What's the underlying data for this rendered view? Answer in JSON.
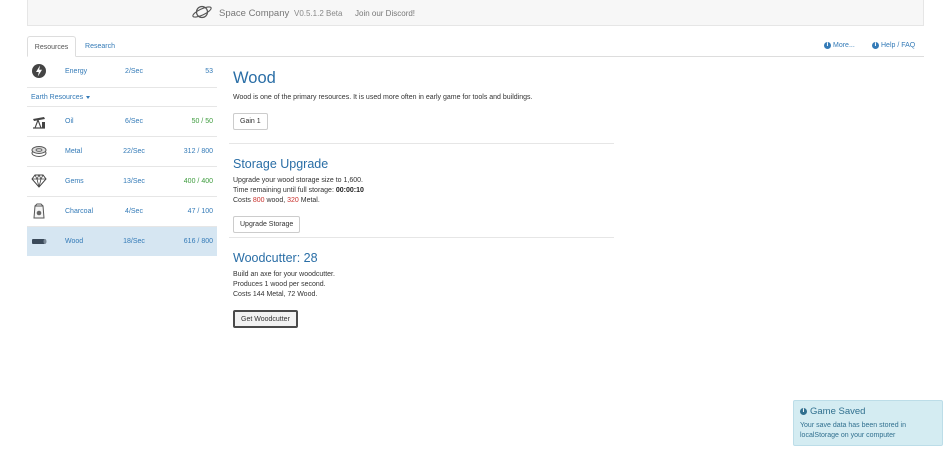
{
  "navbar": {
    "brand_name": "Space Company",
    "version": "V0.5.1.2 Beta",
    "discord_link": "Join our Discord!"
  },
  "tabs": [
    {
      "label": "Resources",
      "active": true
    },
    {
      "label": "Research",
      "active": false
    }
  ],
  "top_links": {
    "more": "More...",
    "help": "Help / FAQ"
  },
  "sidebar": {
    "energy": {
      "name": "Energy",
      "rate": "2/Sec",
      "amount": "53"
    },
    "category_label": "Earth Resources",
    "resources": [
      {
        "name": "Oil",
        "rate": "6/Sec",
        "amount": "50",
        "capacity": "50",
        "full": true,
        "active": false
      },
      {
        "name": "Metal",
        "rate": "22/Sec",
        "amount": "312",
        "capacity": "800",
        "full": false,
        "active": false
      },
      {
        "name": "Gems",
        "rate": "13/Sec",
        "amount": "400",
        "capacity": "400",
        "full": true,
        "active": false
      },
      {
        "name": "Charcoal",
        "rate": "4/Sec",
        "amount": "47",
        "capacity": "100",
        "full": false,
        "active": false
      },
      {
        "name": "Wood",
        "rate": "18/Sec",
        "amount": "616",
        "capacity": "800",
        "full": false,
        "active": true
      }
    ],
    "separator": " / "
  },
  "main": {
    "title": "Wood",
    "description": "Wood is one of the primary resources. It is used more often in early game for tools and buildings.",
    "gain_button": "Gain 1",
    "storage": {
      "title": "Storage Upgrade",
      "line1": "Upgrade your wood storage size to 1,600.",
      "line2_prefix": "Time remaining until full storage: ",
      "line2_time": "00:00:10",
      "cost_prefix": "Costs ",
      "cost_wood": "800",
      "cost_mid": " wood, ",
      "cost_metal": "320",
      "cost_suffix": " Metal.",
      "button": "Upgrade Storage"
    },
    "woodcutter": {
      "title": "Woodcutter: 28",
      "line1": "Build an axe for your woodcutter.",
      "line2": "Produces 1 wood per second.",
      "line3": "Costs 144 Metal, 72 Wood.",
      "button": "Get Woodcutter"
    }
  },
  "toast": {
    "title": "Game Saved",
    "body": "Your save data has been stored in localStorage on your computer"
  },
  "colors": {
    "link": "#337ab7",
    "title": "#2a6ea6",
    "full": "#3c9b3c",
    "cost_red": "#c9302c",
    "active_row": "#d6e6f2",
    "toast_bg": "#d4ecf2"
  },
  "icons": {
    "brand": "planet-icon",
    "energy": "lightning-icon",
    "oil": "oil-pump-icon",
    "metal": "metal-ingot-icon",
    "gems": "gem-icon",
    "charcoal": "charcoal-bag-icon",
    "wood": "log-icon",
    "info": "info-icon"
  }
}
